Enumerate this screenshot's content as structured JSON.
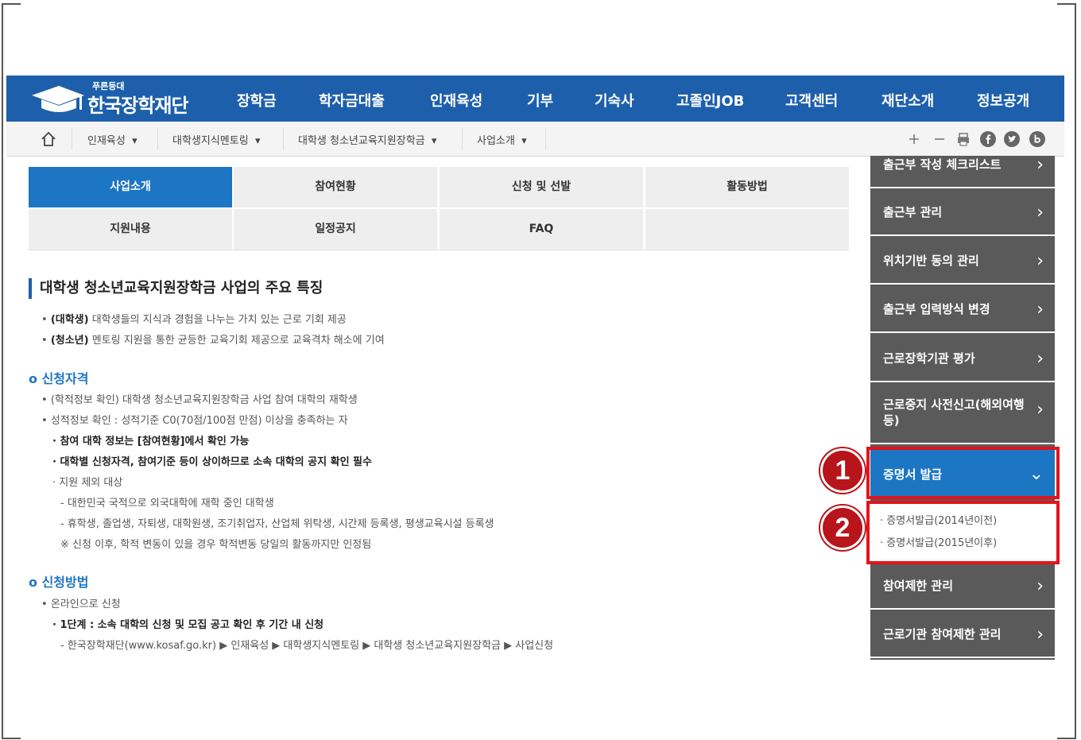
{
  "topnav": {
    "logo_small": "푸른등대",
    "logo_name": "한국장학재단",
    "menu": [
      "장학금",
      "학자금대출",
      "인재육성",
      "기부",
      "기숙사",
      "고졸인JOB",
      "고객센터",
      "재단소개",
      "정보공개"
    ]
  },
  "breadcrumb": {
    "items": [
      "인재육성",
      "대학생지식멘토링",
      "대학생 청소년교육지원장학금",
      "사업소개"
    ]
  },
  "tools": [
    "plus-icon",
    "minus-icon",
    "print-icon",
    "facebook-icon",
    "twitter-icon",
    "blog-icon"
  ],
  "tabs": [
    "사업소개",
    "참여현황",
    "신청 및 선발",
    "활동방법",
    "지원내용",
    "일정공지",
    "FAQ"
  ],
  "content": {
    "title": "대학생 청소년교육지원장학금 사업의 주요 특징",
    "features": [
      {
        "bold": "(대학생)",
        "text": " 대학생들의 지식과 경험을 나누는 가치 있는 근로 기회 제공"
      },
      {
        "bold": "(청소년)",
        "text": " 멘토링 지원을 통한 균등한 교육기회 제공으로 교육격차 해소에 기여"
      }
    ],
    "section1_title": "신청자격",
    "section1_lines": [
      "(학적정보 확인) 대학생 청소년교육지원장학금 사업 참여 대학의 재학생",
      "성적정보 확인 : 성적기준 C0(70점/100점 만점) 이상을 충족하는 자",
      "참여 대학 정보는 [참여현황]에서 확인 가능",
      "대학별 신청자격, 참여기준 등이 상이하므로 소속 대학의 공지 확인 필수",
      "지원 제외 대상",
      "- 대한민국 국적으로 외국대학에 재학 중인 대학생",
      "- 휴학생, 졸업생, 자퇴생, 대학원생, 조기취업자, 산업체 위탁생, 시간제 등록생, 평생교육시설 등록생",
      "※ 신청 이후, 학적 변동이 있을 경우 학적변동 당일의 활동까지만 인정됨"
    ],
    "section2_title": "신청방법",
    "section2_lines": [
      "온라인으로 신청",
      "1단계 : 소속 대학의 신청 및 모집 공고 확인 후 기간 내 신청",
      "- 한국장학재단(www.kosaf.go.kr) ▶ 인재육성 ▶ 대학생지식멘토링 ▶ 대학생 청소년교육지원장학금 ▶ 사업신청"
    ]
  },
  "sidebar": {
    "items": [
      "출근부 작성 체크리스트",
      "출근부 관리",
      "위치기반 동의 관리",
      "출근부 입력방식 변경",
      "근로장학기관 평가",
      "근로중지 사전신고(해외여행 등)",
      "증명서 발급",
      "참여제한 관리",
      "근로기관 참여제한 관리"
    ],
    "sub_items": [
      "증명서발급(2014년이전)",
      "증명서발급(2015년이후)"
    ]
  },
  "annotations": [
    "1",
    "2"
  ],
  "colors": {
    "brand": "#1d5fab",
    "accent": "#1d76c3",
    "highlight": "#e2141b",
    "sidebar": "#5a5a5a"
  }
}
